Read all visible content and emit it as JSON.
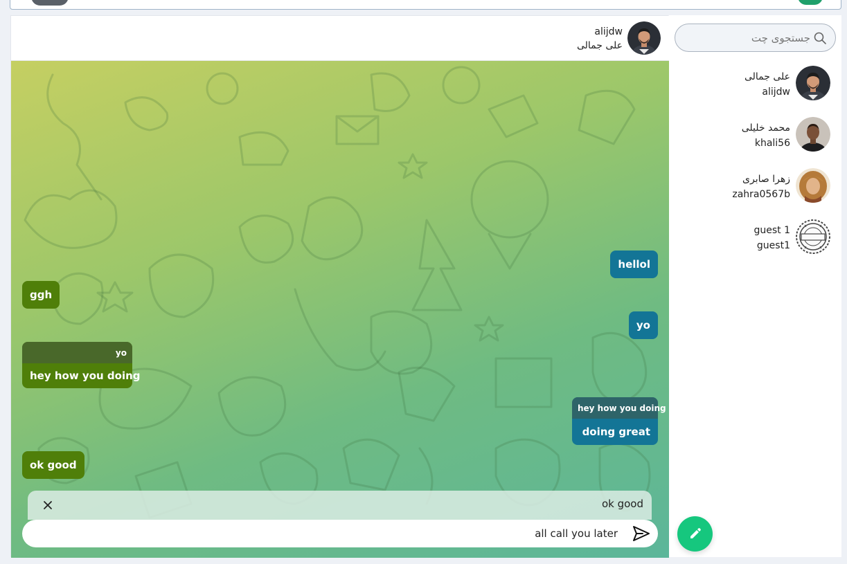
{
  "chat": {
    "header": {
      "username": "alijdw",
      "display_name": "علی جمالی"
    },
    "messages": [
      {
        "id": "m1",
        "direction": "out",
        "text": "hellol"
      },
      {
        "id": "m2",
        "direction": "in",
        "text": "ggh"
      },
      {
        "id": "m3",
        "direction": "out",
        "text": "yo"
      },
      {
        "id": "m4",
        "direction": "in",
        "reply_to": "yo",
        "text": "hey how you doing"
      },
      {
        "id": "m5",
        "direction": "out",
        "reply_to": "hey how you doing",
        "text": "doing great"
      },
      {
        "id": "m6",
        "direction": "in",
        "text": "ok good"
      }
    ],
    "reply_preview": {
      "text": "ok good",
      "close_icon": "close-icon"
    },
    "composer": {
      "value": "all call you later",
      "send_icon": "send-icon"
    }
  },
  "sidebar": {
    "search": {
      "placeholder": "جستجوی چت",
      "icon": "search-icon"
    },
    "contacts": [
      {
        "name": "علی جمالی",
        "username": "alijdw"
      },
      {
        "name": "محمد خلیلی",
        "username": "khali56"
      },
      {
        "name": "زهرا صابری",
        "username": "zahra0567b"
      },
      {
        "name": "guest 1",
        "username": "guest1"
      }
    ],
    "fab_icon": "pencil-icon"
  },
  "colors": {
    "outgoing_bubble": "#137596",
    "incoming_bubble": "#4f7f09",
    "fab": "#16c77e",
    "chat_gradient_start": "#c5cf62",
    "chat_gradient_end": "#5cb69a"
  }
}
